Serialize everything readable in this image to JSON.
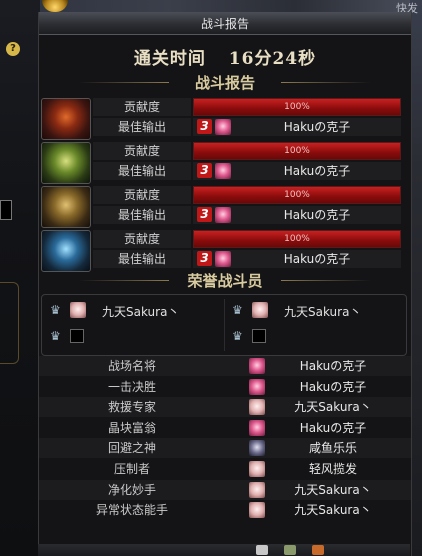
{
  "window": {
    "title": "战斗报告"
  },
  "clear_time": {
    "label": "通关时间",
    "value": "16分24秒"
  },
  "battle_report": {
    "heading": "战斗报告",
    "contribution_label": "贡献度",
    "best_output_label": "最佳输出",
    "players": [
      {
        "portrait": "fire-fiend-portrait",
        "contribution": "100%",
        "contribution_fraction": 1.0,
        "rank_badge": "3",
        "best_output_name": "Hakuの克子"
      },
      {
        "portrait": "forest-fiend-portrait",
        "contribution": "100%",
        "contribution_fraction": 1.0,
        "rank_badge": "3",
        "best_output_name": "Hakuの克子"
      },
      {
        "portrait": "gold-fiend-portrait",
        "contribution": "100%",
        "contribution_fraction": 1.0,
        "rank_badge": "3",
        "best_output_name": "Hakuの克子"
      },
      {
        "portrait": "ice-fiend-portrait",
        "contribution": "100%",
        "contribution_fraction": 1.0,
        "rank_badge": "3",
        "best_output_name": "Hakuの克子"
      }
    ]
  },
  "honor": {
    "heading": "荣誉战斗员",
    "slots": [
      {
        "name": "九天Sakura丶",
        "filled": true
      },
      {
        "name": "九天Sakura丶",
        "filled": true
      },
      {
        "name": "",
        "filled": false
      },
      {
        "name": "",
        "filled": false
      }
    ]
  },
  "awards": [
    {
      "label": "战场名将",
      "name": "Hakuの克子",
      "face": "pink"
    },
    {
      "label": "一击决胜",
      "name": "Hakuの克子",
      "face": "pink"
    },
    {
      "label": "救援专家",
      "name": "九天Sakura丶",
      "face": "light"
    },
    {
      "label": "晶块富翁",
      "name": "Hakuの克子",
      "face": "pink"
    },
    {
      "label": "回避之神",
      "name": "咸鱼乐乐",
      "face": "dark"
    },
    {
      "label": "压制者",
      "name": "轻风揽发",
      "face": "light"
    },
    {
      "label": "净化妙手",
      "name": "九天Sakura丶",
      "face": "light"
    },
    {
      "label": "异常状态能手",
      "name": "九天Sakura丶",
      "face": "light"
    }
  ],
  "side": {
    "help_icon": "?",
    "corner_text": "快发"
  },
  "colors": {
    "accent_red": "#c82020",
    "heading_gold": "#d9cba0"
  }
}
